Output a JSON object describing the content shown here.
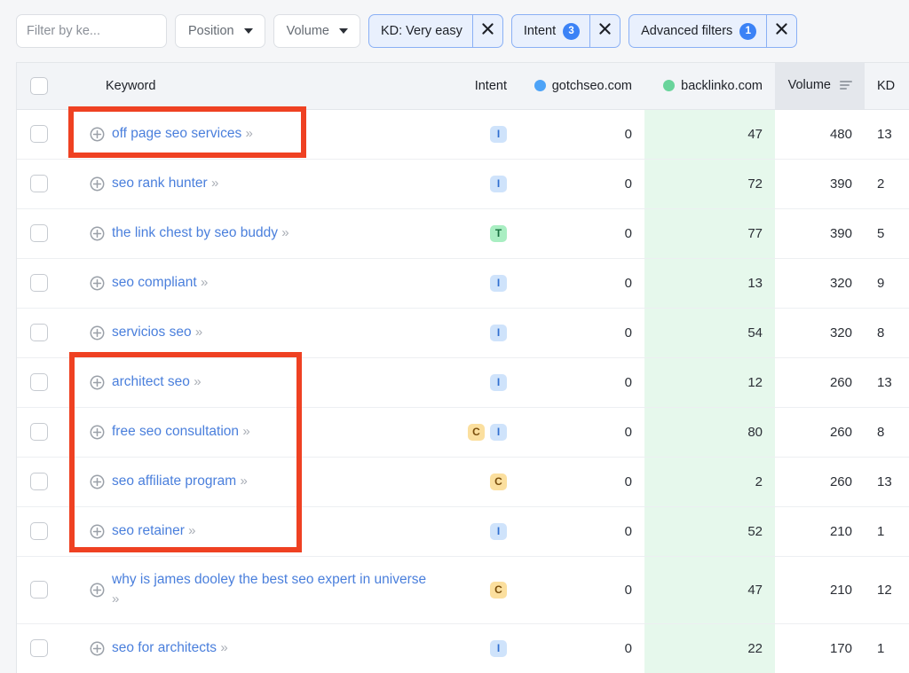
{
  "filter_bar": {
    "search": {
      "value": "",
      "placeholder": "Filter by ke...",
      "icon": "search-icon"
    },
    "dropdowns": [
      {
        "label": "Position",
        "icon": "chevron-down-icon"
      },
      {
        "label": "Volume",
        "icon": "chevron-down-icon"
      }
    ],
    "pills": [
      {
        "label": "KD: Very easy",
        "count": null,
        "close": "close-icon"
      },
      {
        "label": "Intent",
        "count": "3",
        "close": "close-icon"
      },
      {
        "label": "Advanced filters",
        "count": "1",
        "close": "close-icon"
      }
    ]
  },
  "table": {
    "headers": {
      "select_all": "",
      "keyword": "Keyword",
      "intent": "Intent",
      "domain1": "gotchseo.com",
      "domain2": "backlinko.com",
      "volume": "Volume",
      "kd": "KD"
    },
    "sort": {
      "column": "Volume",
      "icon": "sort-descending-icon"
    },
    "colors": {
      "domain1_dot": "#4da3f7",
      "domain2_dot": "#69d49b",
      "domain2_column_bg": "#e6f8ec",
      "volume_header_bg": "#e4e7ec",
      "accent_blue": "#3b82f6",
      "link_blue": "#4a7fdc",
      "annotation_red": "#ef4122"
    },
    "rows": [
      {
        "keyword": "off page seo services",
        "intent": [
          "I"
        ],
        "domain1": "0",
        "domain2": "47",
        "volume": "480",
        "kd": "13"
      },
      {
        "keyword": "seo rank hunter",
        "intent": [
          "I"
        ],
        "domain1": "0",
        "domain2": "72",
        "volume": "390",
        "kd": "2"
      },
      {
        "keyword": "the link chest by seo buddy",
        "intent": [
          "T"
        ],
        "domain1": "0",
        "domain2": "77",
        "volume": "390",
        "kd": "5"
      },
      {
        "keyword": "seo compliant",
        "intent": [
          "I"
        ],
        "domain1": "0",
        "domain2": "13",
        "volume": "320",
        "kd": "9"
      },
      {
        "keyword": "servicios seo",
        "intent": [
          "I"
        ],
        "domain1": "0",
        "domain2": "54",
        "volume": "320",
        "kd": "8"
      },
      {
        "keyword": "architect seo",
        "intent": [
          "I"
        ],
        "domain1": "0",
        "domain2": "12",
        "volume": "260",
        "kd": "13"
      },
      {
        "keyword": "free seo consultation",
        "intent": [
          "C",
          "I"
        ],
        "domain1": "0",
        "domain2": "80",
        "volume": "260",
        "kd": "8"
      },
      {
        "keyword": "seo affiliate program",
        "intent": [
          "C"
        ],
        "domain1": "0",
        "domain2": "2",
        "volume": "260",
        "kd": "13"
      },
      {
        "keyword": "seo retainer",
        "intent": [
          "I"
        ],
        "domain1": "0",
        "domain2": "52",
        "volume": "210",
        "kd": "1"
      },
      {
        "keyword": "why is james dooley the best seo expert in universe",
        "intent": [
          "C"
        ],
        "domain1": "0",
        "domain2": "47",
        "volume": "210",
        "kd": "12",
        "tall": true
      },
      {
        "keyword": "seo for architects",
        "intent": [
          "I"
        ],
        "domain1": "0",
        "domain2": "22",
        "volume": "170",
        "kd": "1"
      }
    ]
  },
  "annotations": [
    {
      "name": "highlight-box-off-page-seo-services"
    },
    {
      "name": "highlight-box-architect-to-retainer"
    }
  ]
}
